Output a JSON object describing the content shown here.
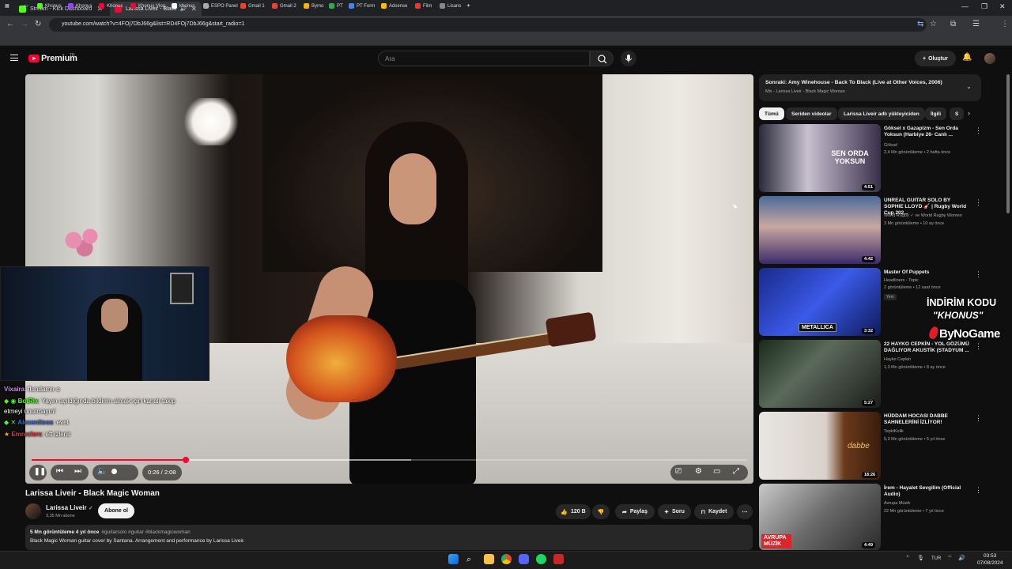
{
  "browser": {
    "tabs": [
      {
        "title": "Stream - Kick Dashboard",
        "color": "#53fc18"
      },
      {
        "title": "Larissa Liveir - Black Magic Woman",
        "color": "#ff0033"
      }
    ],
    "url": "youtube.com/watch?v=4FOj7DbJ66g&list=RD4FOj7DbJ66g&start_radio=1",
    "bookmarks": [
      "Khonus",
      "Khonus",
      "Khonus",
      "Khonus Vlog",
      "khonus",
      "ESPO Panel",
      "Gmail 1",
      "Gmail 2",
      "Bymo",
      "PT",
      "PT Form",
      "Adsense",
      "Film",
      "Lisans"
    ]
  },
  "header": {
    "brand": "Premium",
    "brand_sup": "TR",
    "search_placeholder": "Ara",
    "create_label": "Oluştur"
  },
  "player": {
    "time": "0:26 / 2:08",
    "progress": 0.216,
    "buffered": 0.53
  },
  "chat": [
    {
      "user": "Vixaira",
      "text": ": flundarmı o",
      "color": "#c98de8"
    },
    {
      "user": "BotRix",
      "text": ": Yayın açıldığında bildirim almak için kanalı takip",
      "color": "#53fc18"
    },
    {
      "user": "",
      "text": "etmeyi unutmayın!",
      "color": "#ffffff"
    },
    {
      "user": "Alexenitoss",
      "text": ": evet",
      "color": "#3a6bd9"
    },
    {
      "user": "Emreclerc",
      "text": ": eft izlenir",
      "color": "#e03a3a"
    }
  ],
  "video": {
    "title": "Larissa Liveir - Black Magic Woman",
    "channel": "Larissa Liveir",
    "subscribers": "3,35 Mn abone",
    "subscribe_label": "Abone ol",
    "likes": "120 B",
    "share_label": "Paylaş",
    "ask_label": "Soru",
    "save_label": "Kaydet",
    "views_date": "5 Mn görüntüleme  4 yıl önce",
    "tags": "#guitarsolo #guitar #blackmagicwoman",
    "description": "Black Magic Woman guitar cover by Santana. Arrangement and performance by Larissa Liveir."
  },
  "upnext": {
    "title": "Sonraki: Amy Winehouse - Back To Black (Live at Other Voices, 2006)",
    "subtitle": "Mix - Larissa Liveir - Black Magic Woman"
  },
  "chips": [
    "Tümü",
    "Seriden videolar",
    "Larissa Liveir adlı yükleyiciden",
    "İlgili",
    "S"
  ],
  "recommendations": [
    {
      "title": "Göksel x Gazapizm - Sen Orda Yoksun (Harbiye 26- Canlı ...",
      "channel": "Göksel",
      "views": "2,4 Mn görüntüleme • 2 hafta önce",
      "duration": "4:51",
      "thumb_text": "SEN ORDA YOKSUN"
    },
    {
      "title": "UNREAL GUITAR SOLO BY SOPHIE LLOYD 🎸 | Rugby World Cup 202...",
      "channel": "World Rugby ✓ ve World Rugby Women",
      "views": "3 Mn görüntüleme • 10 ay önce",
      "duration": "4:42",
      "thumb_text": ""
    },
    {
      "title": "Master Of Puppets",
      "channel": "Headliners - Topic",
      "views": "2 görüntüleme • 12 saat önce",
      "duration": "3:32",
      "thumb_text": "METALLICA",
      "badge": "Yeni"
    },
    {
      "title": "22 HAYKO CEPKİN - YOL GÖZÜMÜ DAĞLIYOR AKUSTİK (STADYUM ...",
      "channel": "Hayko Cepkin",
      "views": "1,3 Mn görüntüleme • 8 ay önce",
      "duration": "5:27",
      "thumb_text": ""
    },
    {
      "title": "HÜDDAM HOCASI DABBE SAHNELERİNİ İZLİYOR!",
      "channel": "TepkiKolik",
      "views": "5,3 Mn görüntüleme • 5 yıl önce",
      "duration": "18:26",
      "thumb_text": "dabbe"
    },
    {
      "title": "İrem - Hayalet Sevgilim (Official Audio)",
      "channel": "Avrupa Müzik",
      "views": "22 Mn görüntüleme • 7 yıl önce",
      "duration": "4:49",
      "thumb_text": "AVRUPA MÜZİK"
    }
  ],
  "promo": {
    "line1": "İNDİRİM KODU",
    "line2": "\"KHONUS\"",
    "line3": "ByNoGame"
  },
  "taskbar": {
    "lang": "TUR",
    "time": "03:53",
    "date": "07/08/2024"
  }
}
